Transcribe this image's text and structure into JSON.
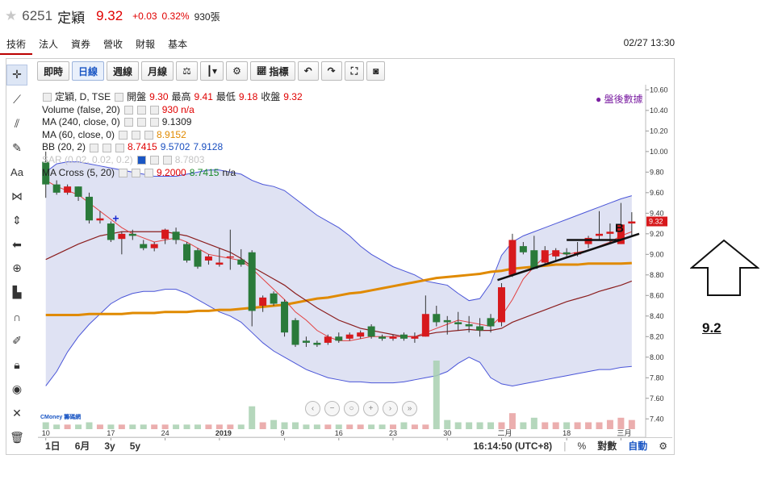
{
  "header": {
    "code": "6251",
    "name": "定穎",
    "price": "9.32",
    "change": "+0.03",
    "change_pct": "0.32%",
    "volume": "930張"
  },
  "tabs": [
    "技術",
    "法人",
    "資券",
    "營收",
    "財報",
    "基本"
  ],
  "datetime": "02/27 13:30",
  "toolbar": {
    "buttons": [
      "即時",
      "日線",
      "週線",
      "月線"
    ],
    "indicator_label": "指標"
  },
  "legend": {
    "title": "定穎, D, TSE",
    "open_label": "開盤",
    "open": "9.30",
    "high_label": "最高",
    "high": "9.41",
    "low_label": "最低",
    "low": "9.18",
    "close_label": "收盤",
    "close": "9.32",
    "volume_label": "Volume (false, 20)",
    "volume_val": "930 n/a",
    "ma240_label": "MA (240, close, 0)",
    "ma240_val": "9.1309",
    "ma60_label": "MA (60, close, 0)",
    "ma60_val": "8.9152",
    "bb_label": "BB (20, 2)",
    "bb_lower": "8.7415",
    "bb_mid": "9.5702",
    "bb_upper": "7.9128",
    "sar_label": "SAR (0.02, 0.02, 0.2)",
    "sar_val": "8.7803",
    "macross_label": "MA Cross (5, 20)",
    "macross_a": "9.2000",
    "macross_b": "8.7415",
    "macross_c": "n/a"
  },
  "after_hours": "盤後數據",
  "bottom": {
    "ranges": [
      "1日",
      "6月",
      "3y",
      "5y"
    ],
    "clock": "16:14:50 (UTC+8)",
    "log_label": "對數",
    "auto_label": "自動"
  },
  "logo_text": "CMoney 籌碼網",
  "annotation": {
    "b_label": "B",
    "target": "9.2"
  },
  "colors": {
    "up": "#d7191c",
    "down": "#2a7a3a",
    "ma240": "#e08a00",
    "bb_band": "#4a55d8",
    "bb_fill": "#dcdff2",
    "ma5": "#e34040",
    "ma20": "#8b1e1e"
  },
  "chart_data": {
    "type": "candlestick",
    "price_axis": {
      "ticks": [
        7.4,
        7.6,
        7.8,
        8.0,
        8.2,
        8.4,
        8.6,
        8.8,
        9.0,
        9.2,
        9.4,
        9.6,
        9.8,
        10.0,
        10.2,
        10.4,
        10.6
      ],
      "tick_labels": [
        "7.40",
        "7.60",
        "7.80",
        "8.00",
        "8.20",
        "8.40",
        "8.60",
        "8.80",
        "9.00",
        "9.20",
        "9.40",
        "9.60",
        "9.80",
        "10.00",
        "10.20",
        "10.40",
        "10.60"
      ],
      "range": [
        7.3,
        10.65
      ],
      "last_price_label": "9.32"
    },
    "x_axis": {
      "tick_labels": [
        "10",
        "17",
        "24",
        "2019",
        "9",
        "16",
        "23",
        "30",
        "二月",
        "18",
        "三月"
      ],
      "tick_index": [
        0,
        6,
        11,
        16,
        22,
        27,
        32,
        37,
        42,
        48,
        53
      ]
    },
    "candles": [
      {
        "o": 9.9,
        "h": 10.0,
        "l": 9.55,
        "c": 9.68
      },
      {
        "o": 9.68,
        "h": 9.72,
        "l": 9.58,
        "c": 9.6
      },
      {
        "o": 9.6,
        "h": 9.68,
        "l": 9.58,
        "c": 9.66
      },
      {
        "o": 9.66,
        "h": 9.66,
        "l": 9.52,
        "c": 9.56
      },
      {
        "o": 9.56,
        "h": 9.6,
        "l": 9.3,
        "c": 9.33
      },
      {
        "o": 9.33,
        "h": 9.42,
        "l": 9.3,
        "c": 9.35
      },
      {
        "o": 9.3,
        "h": 9.32,
        "l": 9.12,
        "c": 9.14
      },
      {
        "o": 9.15,
        "h": 9.22,
        "l": 9.0,
        "c": 9.2
      },
      {
        "o": 9.2,
        "h": 9.24,
        "l": 9.14,
        "c": 9.18
      },
      {
        "o": 9.1,
        "h": 9.14,
        "l": 9.04,
        "c": 9.06
      },
      {
        "o": 9.06,
        "h": 9.12,
        "l": 9.03,
        "c": 9.1
      },
      {
        "o": 9.15,
        "h": 9.25,
        "l": 9.1,
        "c": 9.24
      },
      {
        "o": 9.22,
        "h": 9.26,
        "l": 9.1,
        "c": 9.14
      },
      {
        "o": 9.1,
        "h": 9.12,
        "l": 8.92,
        "c": 8.94
      },
      {
        "o": 9.04,
        "h": 9.06,
        "l": 8.86,
        "c": 8.88
      },
      {
        "o": 8.94,
        "h": 9.0,
        "l": 8.9,
        "c": 8.98
      },
      {
        "o": 8.9,
        "h": 9.06,
        "l": 8.88,
        "c": 8.92
      },
      {
        "o": 8.98,
        "h": 9.24,
        "l": 8.85,
        "c": 8.98
      },
      {
        "o": 8.95,
        "h": 9.05,
        "l": 8.88,
        "c": 8.9
      },
      {
        "o": 9.02,
        "h": 9.04,
        "l": 8.3,
        "c": 8.45
      },
      {
        "o": 8.5,
        "h": 8.6,
        "l": 8.44,
        "c": 8.58
      },
      {
        "o": 8.62,
        "h": 8.64,
        "l": 8.5,
        "c": 8.52
      },
      {
        "o": 8.54,
        "h": 8.56,
        "l": 8.2,
        "c": 8.24
      },
      {
        "o": 8.36,
        "h": 8.38,
        "l": 8.1,
        "c": 8.12
      },
      {
        "o": 8.16,
        "h": 8.2,
        "l": 8.1,
        "c": 8.14
      },
      {
        "o": 8.14,
        "h": 8.16,
        "l": 8.1,
        "c": 8.12
      },
      {
        "o": 8.14,
        "h": 8.22,
        "l": 8.12,
        "c": 8.2
      },
      {
        "o": 8.2,
        "h": 8.24,
        "l": 8.14,
        "c": 8.16
      },
      {
        "o": 8.18,
        "h": 8.24,
        "l": 8.16,
        "c": 8.22
      },
      {
        "o": 8.2,
        "h": 8.26,
        "l": 8.18,
        "c": 8.24
      },
      {
        "o": 8.3,
        "h": 8.32,
        "l": 8.18,
        "c": 8.2
      },
      {
        "o": 8.2,
        "h": 8.22,
        "l": 8.16,
        "c": 8.18
      },
      {
        "o": 8.18,
        "h": 8.22,
        "l": 8.16,
        "c": 8.2
      },
      {
        "o": 8.22,
        "h": 8.24,
        "l": 8.16,
        "c": 8.18
      },
      {
        "o": 8.18,
        "h": 8.24,
        "l": 8.14,
        "c": 8.2
      },
      {
        "o": 8.2,
        "h": 8.6,
        "l": 8.2,
        "c": 8.42
      },
      {
        "o": 8.42,
        "h": 8.5,
        "l": 8.3,
        "c": 8.34
      },
      {
        "o": 8.36,
        "h": 8.4,
        "l": 8.22,
        "c": 8.34
      },
      {
        "o": 8.34,
        "h": 8.44,
        "l": 8.26,
        "c": 8.32
      },
      {
        "o": 8.32,
        "h": 8.4,
        "l": 8.24,
        "c": 8.3
      },
      {
        "o": 8.3,
        "h": 8.38,
        "l": 8.2,
        "c": 8.26
      },
      {
        "o": 8.38,
        "h": 8.42,
        "l": 8.24,
        "c": 8.3
      },
      {
        "o": 8.34,
        "h": 8.72,
        "l": 8.3,
        "c": 8.68
      },
      {
        "o": 8.8,
        "h": 9.2,
        "l": 8.78,
        "c": 9.14
      },
      {
        "o": 9.08,
        "h": 9.12,
        "l": 9.0,
        "c": 9.02
      },
      {
        "o": 9.04,
        "h": 9.18,
        "l": 8.86,
        "c": 8.86
      },
      {
        "o": 8.92,
        "h": 9.08,
        "l": 8.9,
        "c": 9.04
      },
      {
        "o": 8.98,
        "h": 9.06,
        "l": 8.94,
        "c": 9.04
      },
      {
        "o": 9.02,
        "h": 9.06,
        "l": 8.98,
        "c": 9.0
      },
      {
        "o": 9.0,
        "h": 9.12,
        "l": 8.98,
        "c": 9.02
      },
      {
        "o": 9.1,
        "h": 9.18,
        "l": 9.06,
        "c": 9.16
      },
      {
        "o": 9.18,
        "h": 9.42,
        "l": 9.14,
        "c": 9.2
      },
      {
        "o": 9.2,
        "h": 9.3,
        "l": 9.1,
        "c": 9.22
      },
      {
        "o": 9.1,
        "h": 9.5,
        "l": 9.1,
        "c": 9.29
      },
      {
        "o": 9.3,
        "h": 9.41,
        "l": 9.18,
        "c": 9.32
      }
    ],
    "volume": [
      3,
      2,
      2,
      2,
      3,
      2,
      2,
      2,
      2,
      2,
      2,
      2,
      2,
      2,
      2,
      2,
      2,
      2,
      2,
      10,
      3,
      4,
      3,
      3,
      2,
      2,
      2,
      2,
      2,
      2,
      2,
      2,
      2,
      3,
      2,
      2,
      30,
      4,
      3,
      3,
      3,
      3,
      3,
      7,
      3,
      5,
      3,
      3,
      3,
      3,
      3,
      3,
      4,
      5,
      4
    ],
    "ma240": [
      8.41,
      8.41,
      8.41,
      8.41,
      8.42,
      8.42,
      8.42,
      8.42,
      8.43,
      8.43,
      8.43,
      8.44,
      8.44,
      8.44,
      8.45,
      8.45,
      8.46,
      8.46,
      8.47,
      8.48,
      8.49,
      8.5,
      8.51,
      8.53,
      8.55,
      8.57,
      8.58,
      8.6,
      8.62,
      8.63,
      8.65,
      8.67,
      8.69,
      8.71,
      8.73,
      8.75,
      8.77,
      8.78,
      8.79,
      8.8,
      8.81,
      8.83,
      8.84,
      8.86,
      8.87,
      8.88,
      8.89,
      8.9,
      8.9,
      8.9,
      8.91,
      8.91,
      8.91,
      8.91,
      8.915
    ],
    "bb_upper": [
      9.8,
      9.88,
      9.9,
      9.9,
      9.88,
      9.86,
      9.84,
      9.82,
      9.8,
      9.78,
      9.76,
      9.76,
      9.76,
      9.78,
      9.8,
      9.82,
      9.82,
      9.8,
      9.78,
      9.72,
      9.68,
      9.66,
      9.62,
      9.54,
      9.46,
      9.38,
      9.32,
      9.26,
      9.18,
      9.08,
      9.0,
      8.94,
      8.88,
      8.84,
      8.8,
      8.74,
      8.72,
      8.7,
      8.62,
      8.55,
      8.57,
      8.72,
      8.99,
      9.12,
      9.18,
      9.22,
      9.26,
      9.3,
      9.34,
      9.38,
      9.42,
      9.46,
      9.5,
      9.54,
      9.57
    ],
    "bb_lower": [
      7.72,
      7.86,
      8.05,
      8.2,
      8.32,
      8.42,
      8.52,
      8.58,
      8.62,
      8.64,
      8.64,
      8.66,
      8.66,
      8.62,
      8.56,
      8.5,
      8.44,
      8.4,
      8.34,
      8.24,
      8.14,
      8.06,
      8.0,
      7.94,
      7.88,
      7.84,
      7.8,
      7.78,
      7.76,
      7.76,
      7.75,
      7.75,
      7.75,
      7.76,
      7.78,
      7.8,
      7.82,
      7.86,
      7.94,
      8.0,
      7.95,
      7.8,
      7.74,
      7.72,
      7.74,
      7.76,
      7.78,
      7.8,
      7.82,
      7.84,
      7.86,
      7.88,
      7.88,
      7.9,
      7.91
    ],
    "ma20": [
      8.95,
      9.0,
      9.05,
      9.1,
      9.14,
      9.18,
      9.2,
      9.22,
      9.22,
      9.22,
      9.22,
      9.22,
      9.2,
      9.18,
      9.14,
      9.1,
      9.06,
      9.02,
      8.96,
      8.88,
      8.82,
      8.76,
      8.7,
      8.62,
      8.55,
      8.48,
      8.42,
      8.36,
      8.32,
      8.28,
      8.26,
      8.24,
      8.22,
      8.2,
      8.2,
      8.22,
      8.24,
      8.25,
      8.26,
      8.27,
      8.26,
      8.26,
      8.28,
      8.34,
      8.38,
      8.42,
      8.46,
      8.5,
      8.54,
      8.57,
      8.6,
      8.64,
      8.67,
      8.7,
      8.74
    ],
    "ma5": [
      9.72,
      9.66,
      9.62,
      9.58,
      9.5,
      9.42,
      9.34,
      9.26,
      9.2,
      9.16,
      9.12,
      9.14,
      9.16,
      9.12,
      9.06,
      9.0,
      8.98,
      8.96,
      8.94,
      8.86,
      8.76,
      8.66,
      8.56,
      8.44,
      8.36,
      8.26,
      8.2,
      8.16,
      8.16,
      8.18,
      8.2,
      8.2,
      8.2,
      8.2,
      8.2,
      8.24,
      8.28,
      8.32,
      8.36,
      8.34,
      8.32,
      8.3,
      8.4,
      8.56,
      8.76,
      8.88,
      8.98,
      9.02,
      9.0,
      9.02,
      9.04,
      9.08,
      9.12,
      9.18,
      9.22
    ]
  }
}
